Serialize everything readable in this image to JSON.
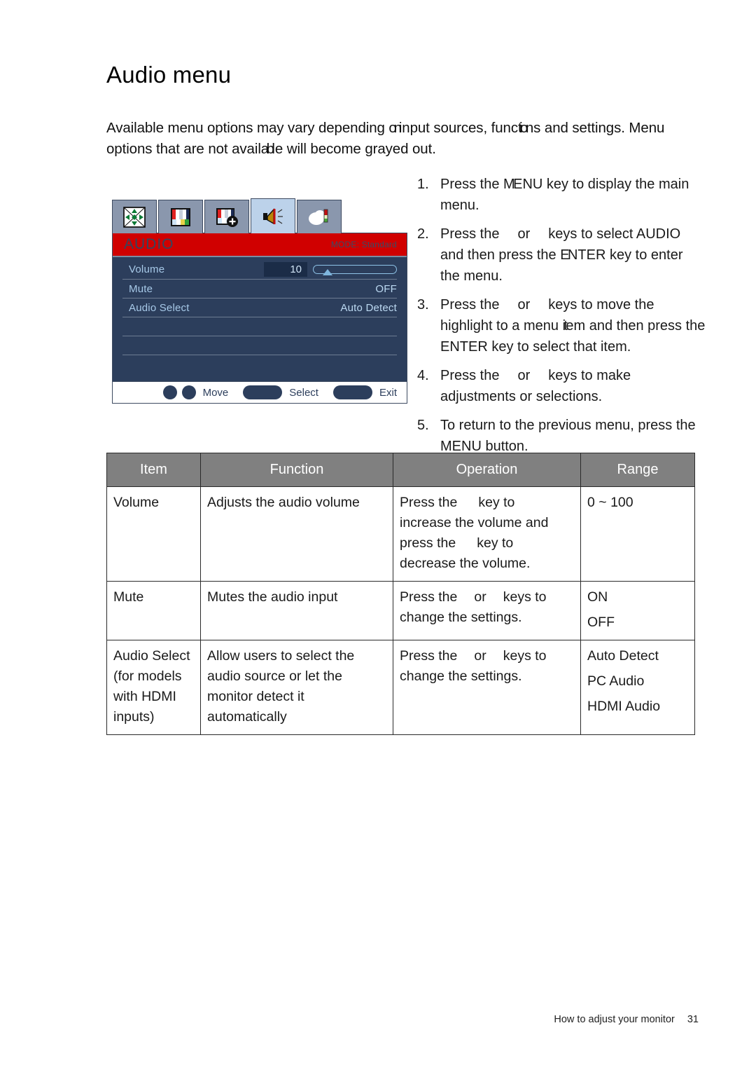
{
  "document": {
    "title": "Audio menu",
    "intro_line1_a": "Available menu options may vary depending ",
    "intro_line1_b": "on",
    "intro_line1_c": "input sources, func",
    "intro_line1_d": "tio",
    "intro_line1_e": "ns and settings. Menu",
    "intro_line2_a": "options that are not avail",
    "intro_line2_b": "ab",
    "intro_line2_c": "le will become grayed out.",
    "intro_full": "Available menu options may vary depending on input sources, functions and settings. Menu options that are not available will become grayed out."
  },
  "osd": {
    "tabs": [
      {
        "name": "display-icon",
        "label": "Display"
      },
      {
        "name": "picture-icon",
        "label": "Picture"
      },
      {
        "name": "picture-advanced-icon",
        "label": "Picture Advanced"
      },
      {
        "name": "audio-icon",
        "label": "Audio",
        "active": true
      },
      {
        "name": "system-icon",
        "label": "System"
      }
    ],
    "header_title": "AUDIO",
    "header_mode": "MODE: Standard",
    "rows": [
      {
        "label": "Volume",
        "value": "10",
        "type": "slider"
      },
      {
        "label": "Mute",
        "value": "OFF",
        "type": "value"
      },
      {
        "label": "Audio Select",
        "value": "Auto Detect",
        "type": "value"
      },
      {
        "label": "",
        "value": "",
        "type": "blank"
      },
      {
        "label": "",
        "value": "",
        "type": "blank"
      },
      {
        "label": "",
        "value": "",
        "type": "blank"
      }
    ],
    "footer": {
      "move_label": "Move",
      "select_label": "Select",
      "exit_label": "Exit"
    },
    "colors": {
      "header_red": "#d00000",
      "panel_navy": "#2c3e5c",
      "text_lightblue": "#a7c9e8",
      "tab_active": "#bcd2ea",
      "tab_inactive": "#8a97ad"
    }
  },
  "steps": [
    {
      "num": "1.",
      "a": "Press the ",
      "b": "M",
      "c": "ENU key to display the main menu.",
      "full": "Press the MENU key to display the main menu."
    },
    {
      "num": "2.",
      "a": "Press the",
      "b": "or",
      "c": "keys to select AUDIO and then press the ",
      "d": "E",
      "e": "NTER key to enter the menu.",
      "full": "Press the or keys to select AUDIO and then press the ENTER key to enter the menu."
    },
    {
      "num": "3.",
      "a": "Press the",
      "b": "or",
      "c": "keys to move the highlight to a menu ",
      "d": "it",
      "e": "em and then press the ENTER key to select that item.",
      "full": "Press the or keys to move the highlight to a menu item and then press the ENTER key to select that item."
    },
    {
      "num": "4.",
      "a": "Press the",
      "b": "or",
      "c": "keys to make adjustments or selections.",
      "full": "Press the or keys to make adjustments or selections."
    },
    {
      "num": "5.",
      "a": "To return to the previous menu, press the MENU button.",
      "full": "To return to the previous menu, press the MENU button."
    }
  ],
  "table": {
    "headers": [
      "Item",
      "Function",
      "Operation",
      "Range"
    ],
    "rows": [
      {
        "item": "Volume",
        "function": "Adjusts the audio volume",
        "operation_lines": [
          "Press the",
          "key to",
          "increase the volume and",
          "press the",
          "key to",
          "decrease the volume."
        ],
        "operation_full": "Press the key to increase the volume and press the key to decrease the volume.",
        "range_lines": [
          "0 ~ 100"
        ]
      },
      {
        "item": "Mute",
        "function": "Mutes the audio input",
        "operation_lines": [
          "Press the",
          "or",
          "keys to",
          "change the settings."
        ],
        "operation_full": "Press the or keys to change the settings.",
        "range_lines": [
          "ON",
          "OFF"
        ]
      },
      {
        "item": "Audio Select (for models with HDMI inputs)",
        "item_lines": [
          "Audio Select",
          "(for models",
          "with HDMI",
          "inputs)"
        ],
        "function": "Allow users to select the audio source or let the monitor detect it automatically",
        "operation_lines": [
          "Press the",
          "or",
          "keys to",
          "change the settings."
        ],
        "operation_full": "Press the or keys to change the settings.",
        "range_lines": [
          "Auto Detect",
          "PC Audio",
          "HDMI Audio"
        ]
      }
    ]
  },
  "footer": {
    "text": "How to adjust your monitor",
    "page_number": "31"
  }
}
